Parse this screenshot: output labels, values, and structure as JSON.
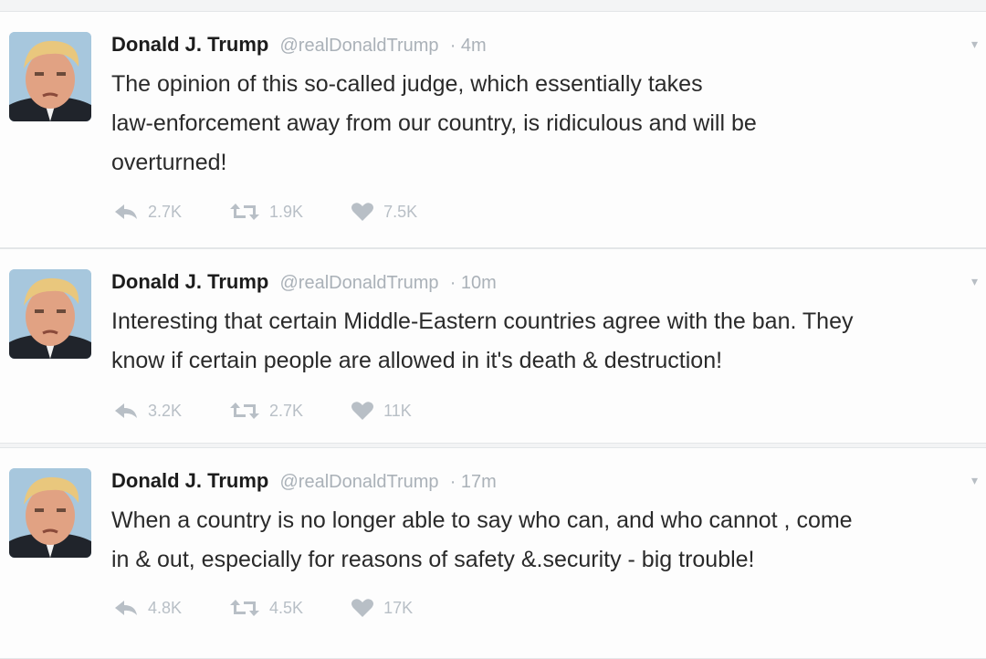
{
  "tweets": [
    {
      "name": "Donald J. Trump",
      "handle": "@realDonaldTrump",
      "time": "· 4m",
      "lines": [
        "The opinion of this so-called judge, which essentially takes",
        "law-enforcement away from our country, is ridiculous and will be",
        "overturned!"
      ],
      "replies": "2.7K",
      "retweets": "1.9K",
      "likes": "7.5K"
    },
    {
      "name": "Donald J. Trump",
      "handle": "@realDonaldTrump",
      "time": "· 10m",
      "lines": [
        "Interesting that certain Middle-Eastern countries agree with the ban. They",
        "know if certain people are allowed in it's death & destruction!"
      ],
      "replies": "3.2K",
      "retweets": "2.7K",
      "likes": "11K"
    },
    {
      "name": "Donald J. Trump",
      "handle": "@realDonaldTrump",
      "time": "· 17m",
      "lines": [
        "When a country is no longer able to say who can, and who cannot , come",
        "in & out, especially for reasons of safety &.security - big trouble!"
      ],
      "replies": "4.8K",
      "retweets": "4.5K",
      "likes": "17K"
    }
  ],
  "icons": {
    "reply": "reply-icon",
    "retweet": "retweet-icon",
    "like": "heart-icon",
    "more": "chevron-down-icon"
  },
  "colors": {
    "action_gray": "#b8bfc6",
    "meta_gray": "#aab1b8",
    "avatar_bg": "#a7c7dd"
  }
}
